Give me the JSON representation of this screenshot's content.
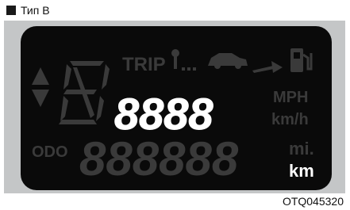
{
  "header": {
    "label": "Тип B"
  },
  "display": {
    "trip_label": "TRIP",
    "speed_digits": "8888",
    "unit_mph": "MPH",
    "unit_kmh": "km/h",
    "odo_label": "ODO",
    "odo_digits": "888888",
    "unit_mi": "mi.",
    "unit_km": "km"
  },
  "footer": {
    "code": "OTQ045320"
  },
  "colors": {
    "screen": "#0a0a0a",
    "dim_segment": "#3a3a3a",
    "lit_segment": "#ffffff",
    "panel": "#c4c6c7"
  }
}
